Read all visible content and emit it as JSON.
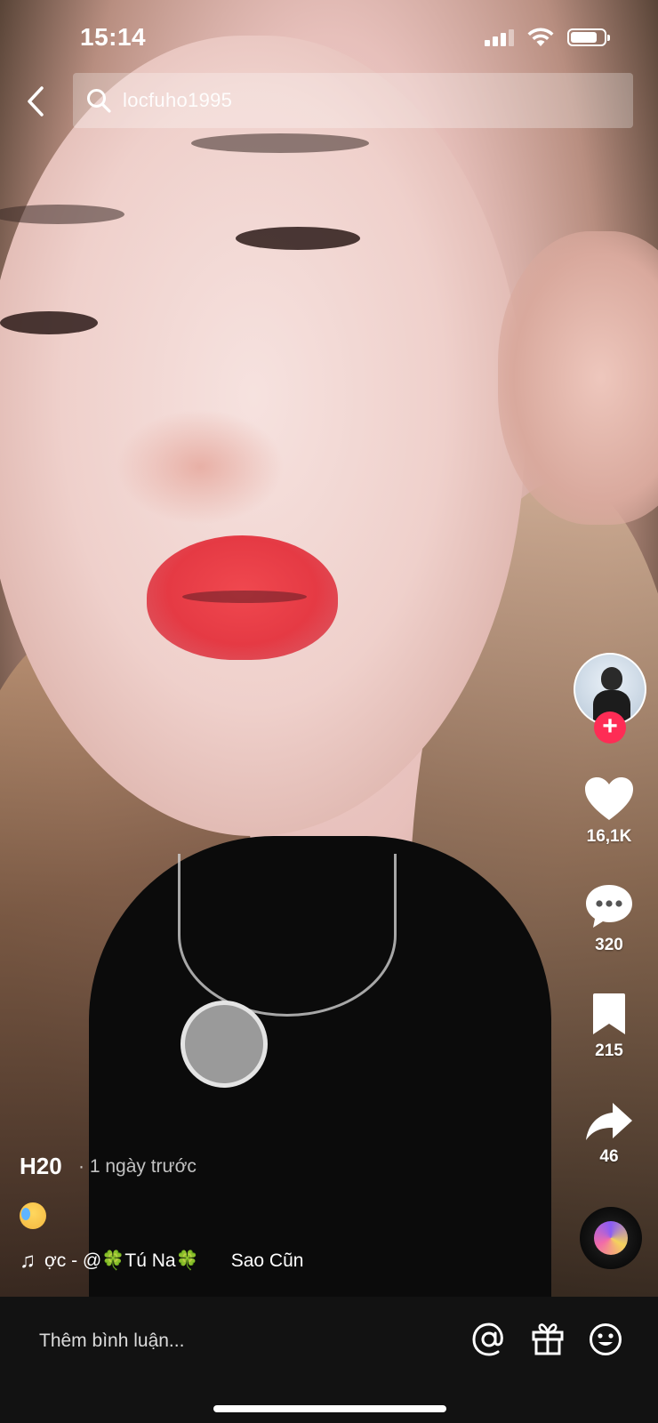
{
  "status_bar": {
    "time": "15:14",
    "battery_level": 0.8,
    "icons": [
      "signal-icon",
      "wifi-icon",
      "battery-icon"
    ]
  },
  "header": {
    "back_icon": "chevron-left-icon",
    "search_icon": "search-icon",
    "search_text": "locfuho1995"
  },
  "actions": {
    "likes": "16,1K",
    "comments": "320",
    "saves": "215",
    "shares": "46",
    "follow_symbol": "+"
  },
  "post": {
    "author": "H20",
    "posted": "· 1 ngày trước",
    "music_note": "♫",
    "music_text": "ợc - @🍀Tú Na🍀",
    "music_text_2": "Sao Cũn"
  },
  "comment_bar": {
    "placeholder": "Thêm bình luận...",
    "icons": [
      "mention-icon",
      "gift-icon",
      "emoji-icon"
    ]
  },
  "colors": {
    "accent_red": "#fe2c55",
    "comment_bar_bg": "#121212"
  }
}
